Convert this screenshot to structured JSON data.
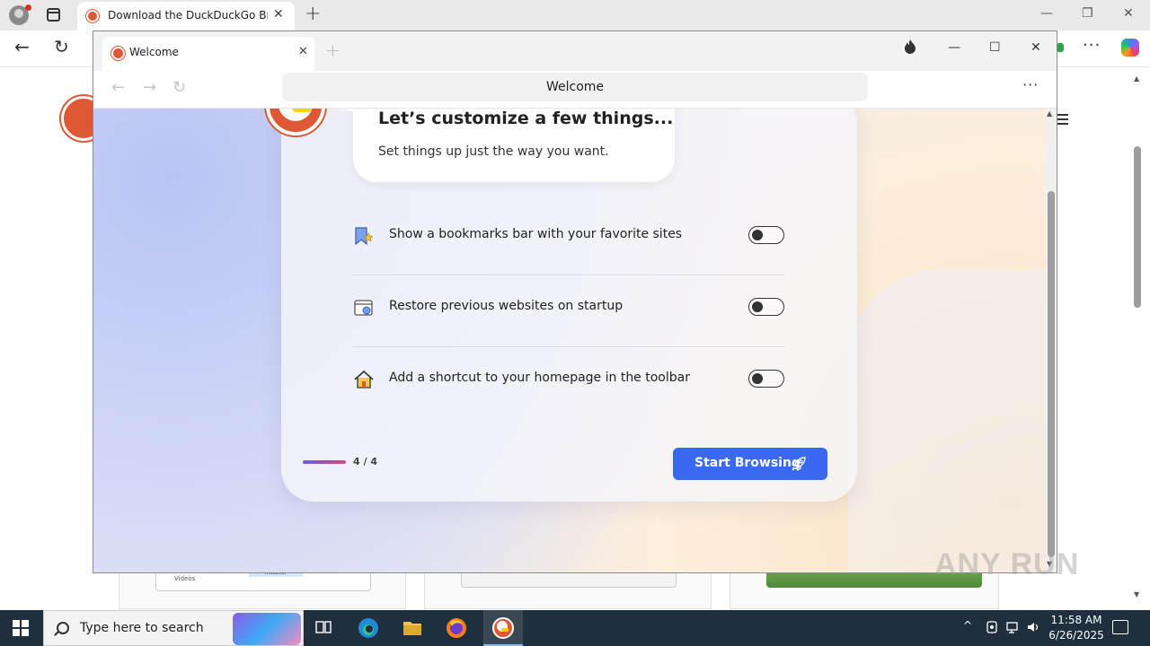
{
  "edge": {
    "tab_title": "Download the DuckDuckGo Browser",
    "tab_close": "✕",
    "new_tab": "+",
    "window_controls": [
      "—",
      "❐",
      "✕"
    ],
    "back": "←",
    "reload": "↻",
    "more": "···",
    "page": {
      "thumb_videos": "Videos",
      "thumb_installer": "Installer"
    }
  },
  "ddg": {
    "tab_title": "Welcome",
    "tab_close": "✕",
    "new_tab": "+",
    "fire_icon": "fire-icon",
    "window_controls": [
      "—",
      "☐",
      "✕"
    ],
    "nav": {
      "back": "←",
      "forward": "→",
      "reload": "↻"
    },
    "address": "Welcome",
    "menu": "···",
    "onboarding": {
      "title": "Let’s customize a few things...",
      "subtitle": "Set things up just the way you want.",
      "options": [
        {
          "label": "Show a bookmarks bar with your favorite sites",
          "icon": "bookmarks-bar-icon",
          "enabled": false
        },
        {
          "label": "Restore previous websites on startup",
          "icon": "restore-session-icon",
          "enabled": false
        },
        {
          "label": "Add a shortcut to your homepage in the toolbar",
          "icon": "home-icon",
          "enabled": false
        }
      ],
      "progress": {
        "label": "4 / 4",
        "current": 4,
        "total": 4
      },
      "start_button": "Start Browsing"
    }
  },
  "taskbar": {
    "search_placeholder": "Type here to search",
    "tray_up": "^",
    "time": "11:58 AM",
    "date": "6/26/2025"
  },
  "watermark": "ANY RUN",
  "colors": {
    "ddg_orange": "#de5833",
    "ddg_blue": "#3969ef",
    "taskbar": "#1f2f3d"
  }
}
